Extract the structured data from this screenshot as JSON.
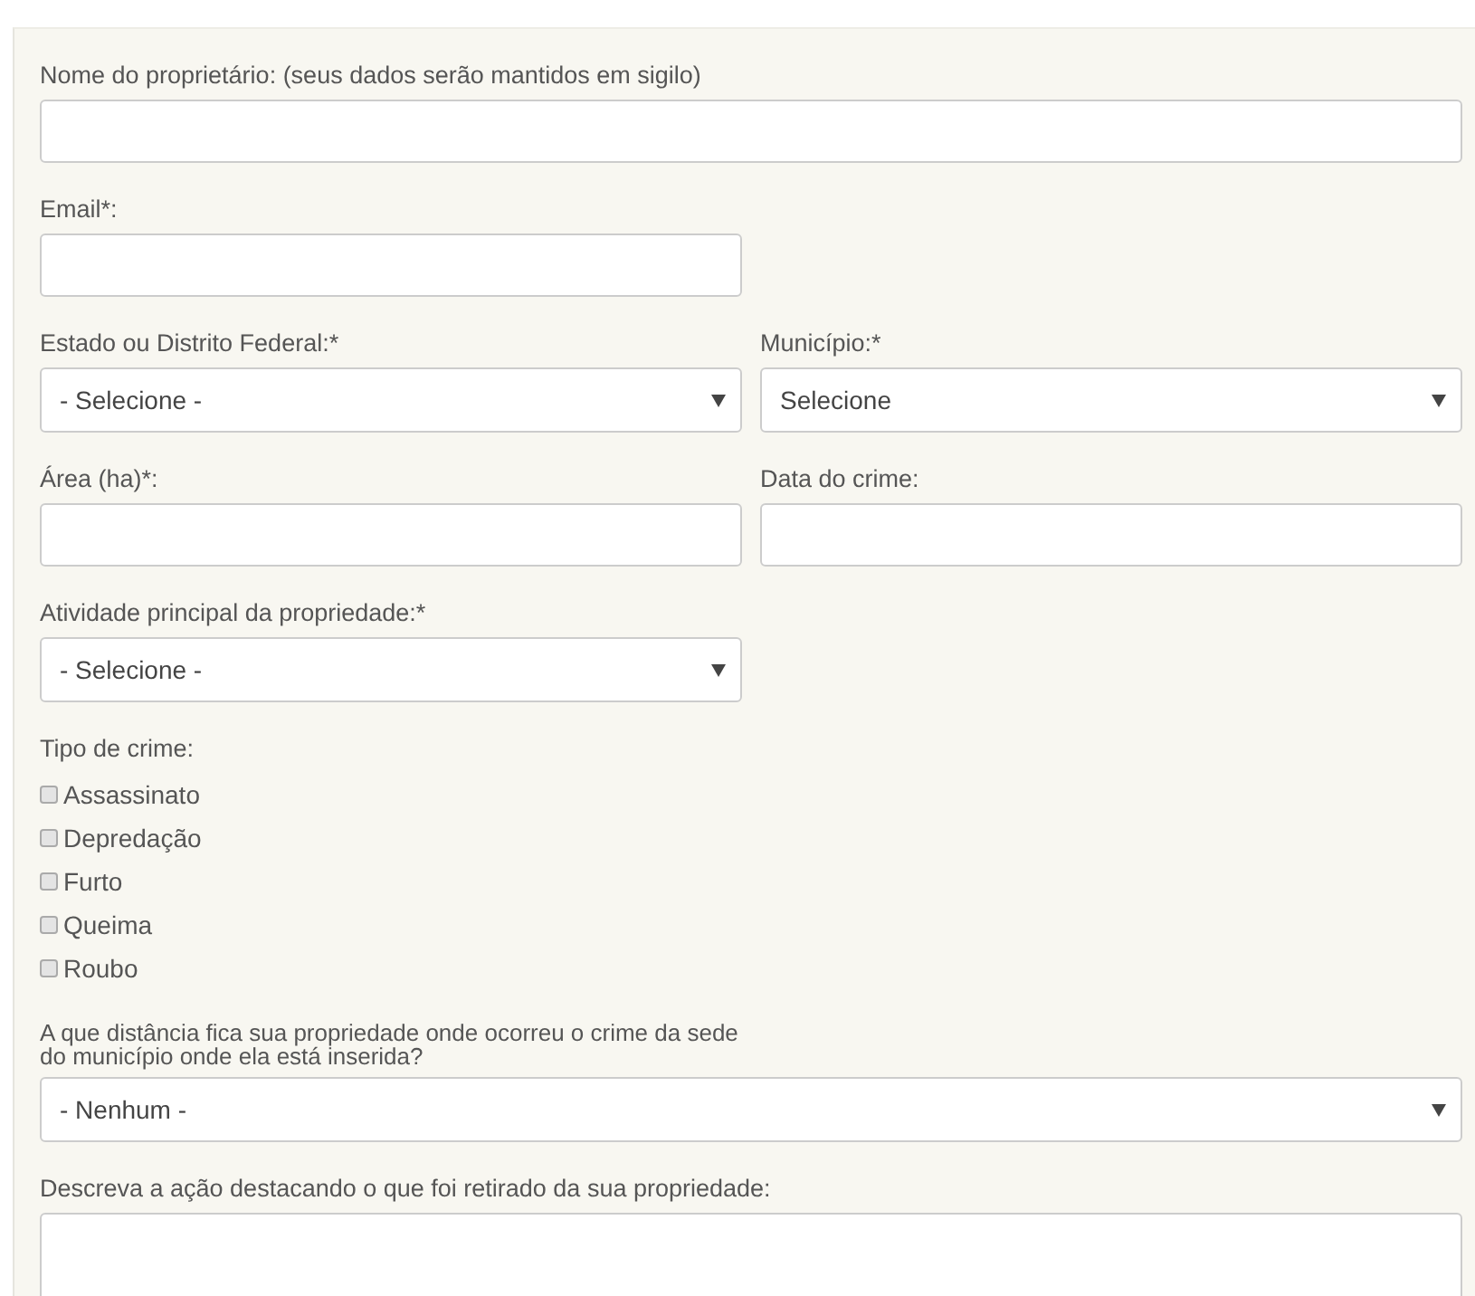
{
  "rows": [
    {
      "fields": [
        {
          "kind": "text",
          "label": "Nome do proprietário: (seus dados serão mantidos em sigilo)",
          "full_width": true
        }
      ]
    },
    {
      "fields": [
        {
          "kind": "text",
          "label": "Email*:",
          "full_width": false
        }
      ]
    },
    {
      "fields": [
        {
          "kind": "select",
          "label": "Estado ou Distrito Federal:*",
          "value": "- Selecione -",
          "full_width": false
        },
        {
          "kind": "select",
          "label": "Município:*",
          "value": "Selecione",
          "full_width": false
        }
      ]
    },
    {
      "fields": [
        {
          "kind": "text",
          "label": "Área (ha)*:",
          "full_width": false
        },
        {
          "kind": "text",
          "label": "Data do crime:",
          "full_width": false
        }
      ]
    },
    {
      "fields": [
        {
          "kind": "select",
          "label": "Atividade principal da propriedade:*",
          "value": "- Selecione -",
          "full_width": false
        }
      ]
    },
    {
      "fields": [
        {
          "kind": "checkboxes",
          "label": "Tipo de crime:",
          "options": [
            {
              "label": "Assassinato",
              "checked": false
            },
            {
              "label": "Depredação",
              "checked": false
            },
            {
              "label": "Furto",
              "checked": false
            },
            {
              "label": "Queima",
              "checked": false
            },
            {
              "label": "Roubo",
              "checked": false
            }
          ]
        }
      ]
    },
    {
      "fields": [
        {
          "kind": "select",
          "label": "A que distância fica sua propriedade onde ocorreu o crime da sede do município onde ela está inserida?",
          "value": "- Nenhum -",
          "full_width": true
        }
      ]
    },
    {
      "fields": [
        {
          "kind": "textarea",
          "label": "Descreva a ação destacando o que foi retirado da sua propriedade:",
          "full_width": true
        }
      ]
    }
  ]
}
